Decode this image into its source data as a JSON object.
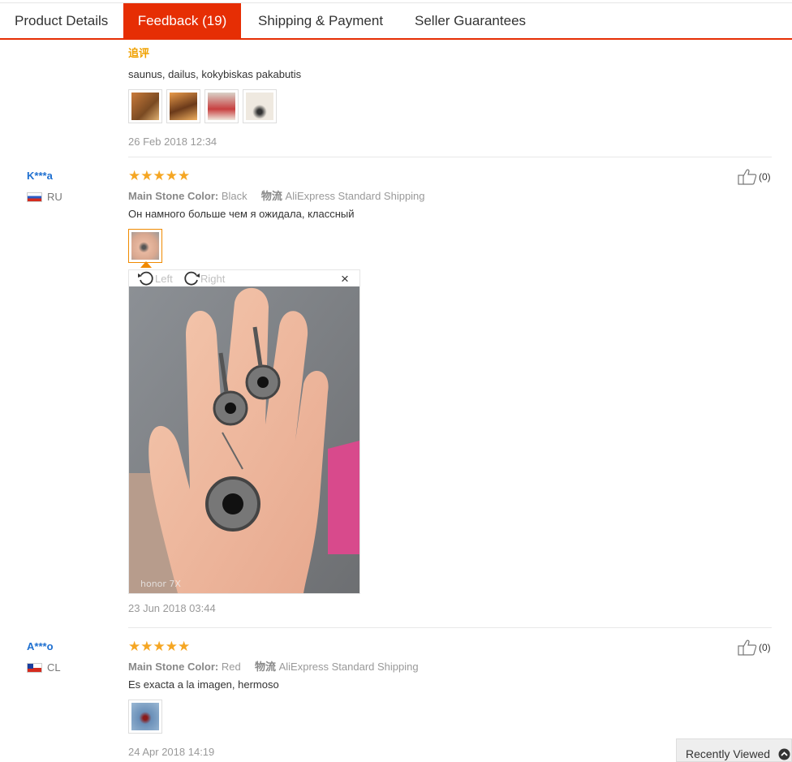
{
  "tabs": [
    {
      "label": "Product Details"
    },
    {
      "label": "Feedback (19)"
    },
    {
      "label": "Shipping & Payment"
    },
    {
      "label": "Seller Guarantees"
    }
  ],
  "review0": {
    "followup_label": "追评",
    "text": "saunus, dailus, kokybiskas pakabutis",
    "date": "26 Feb 2018 12:34"
  },
  "review1": {
    "user": "K***a",
    "country": "RU",
    "rating": "★★★★★",
    "attr_label": "Main Stone Color:",
    "attr_value": "Black",
    "logistics_label": "物流",
    "logistics_value": "AliExpress Standard Shipping",
    "text": "Он намного больше чем я ожидала, классный",
    "likes": "(0)",
    "viewer": {
      "rotate_left": "Left",
      "rotate_right": "Right",
      "close": "×",
      "watermark": "honor 7X"
    },
    "date": "23 Jun 2018 03:44"
  },
  "review2": {
    "user": "A***o",
    "country": "CL",
    "rating": "★★★★★",
    "attr_label": "Main Stone Color:",
    "attr_value": "Red",
    "logistics_label": "物流",
    "logistics_value": "AliExpress Standard Shipping",
    "text": "Es exacta a la imagen, hermoso",
    "likes": "(0)",
    "date": "24 Apr 2018 14:19"
  },
  "recently_viewed": "Recently Viewed",
  "colors": {
    "accent": "#e62e04",
    "star": "#f5a623",
    "link": "#1e6fd0",
    "followup": "#f0a100"
  }
}
